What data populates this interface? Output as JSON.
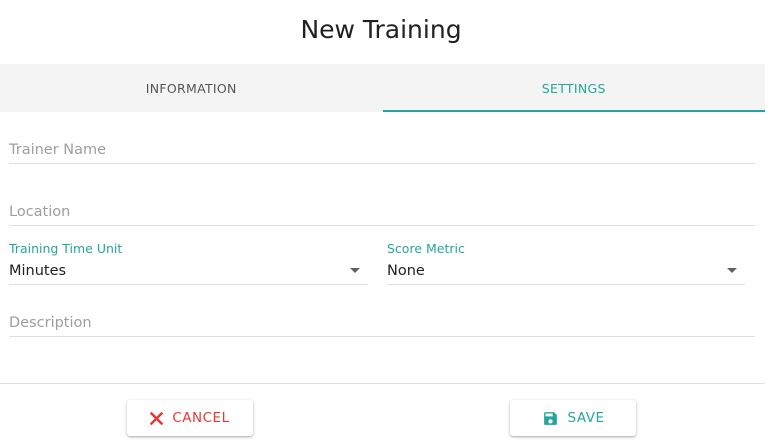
{
  "dialog": {
    "title": "New Training"
  },
  "tabs": [
    {
      "label": "INFORMATION",
      "active": false
    },
    {
      "label": "SETTINGS",
      "active": true
    }
  ],
  "form": {
    "trainer_name": {
      "placeholder": "Trainer Name",
      "value": ""
    },
    "location": {
      "placeholder": "Location",
      "value": ""
    },
    "training_time_unit": {
      "label": "Training Time Unit",
      "value": "Minutes"
    },
    "score_metric": {
      "label": "Score Metric",
      "value": "None"
    },
    "description": {
      "placeholder": "Description",
      "value": ""
    }
  },
  "actions": {
    "cancel_label": "CANCEL",
    "save_label": "SAVE"
  },
  "icons": {
    "cancel": "close-icon",
    "save": "floppy-disk-icon"
  },
  "colors": {
    "accent": "#26a69a",
    "danger": "#e53935",
    "tab_bar_background": "#f4f4f4"
  }
}
